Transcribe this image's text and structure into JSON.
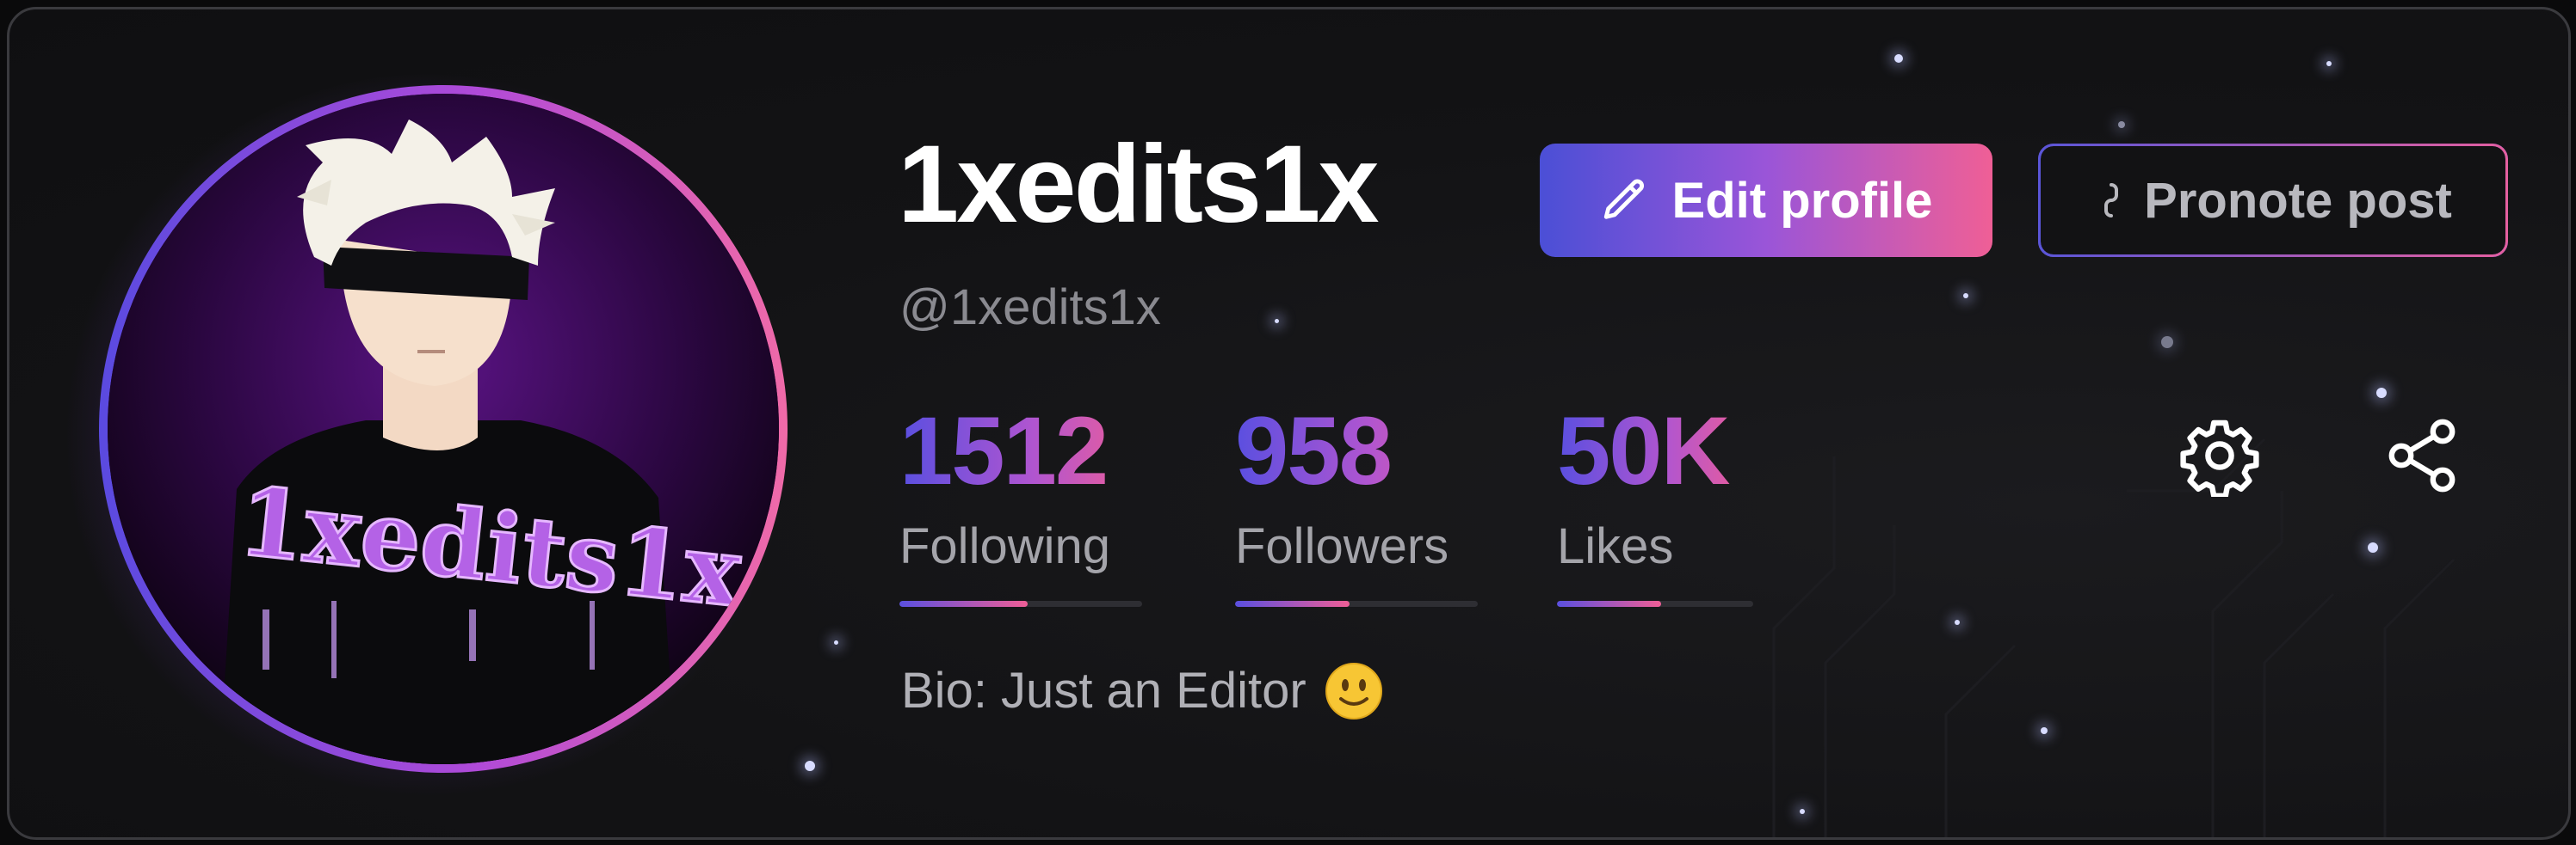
{
  "profile": {
    "username": "1xedits1x",
    "handle": "@1xedits1x",
    "avatar_icon": "anime-avatar-image",
    "bio": "Bio: Just an Editor",
    "bio_emoji_icon": "smiling-face-emoji"
  },
  "actions": {
    "edit_label": "Edit profile",
    "edit_icon": "pencil-icon",
    "promote_label": "Pronote post",
    "promote_icon": "link-icon"
  },
  "stats": [
    {
      "value": "1512",
      "label": "Following",
      "progress": 0.53
    },
    {
      "value": "958",
      "label": "Followers",
      "progress": 0.47
    },
    {
      "value": "50K",
      "label": "Likes",
      "progress": 0.53
    }
  ],
  "toolbar": {
    "settings_icon": "gear-icon",
    "share_icon": "share-icon"
  },
  "colors": {
    "accent_start": "#5a4fe0",
    "accent_mid": "#b055d0",
    "accent_end": "#ef5e96",
    "background": "#131315",
    "text_primary": "#ffffff",
    "text_muted": "#8a8a90"
  }
}
